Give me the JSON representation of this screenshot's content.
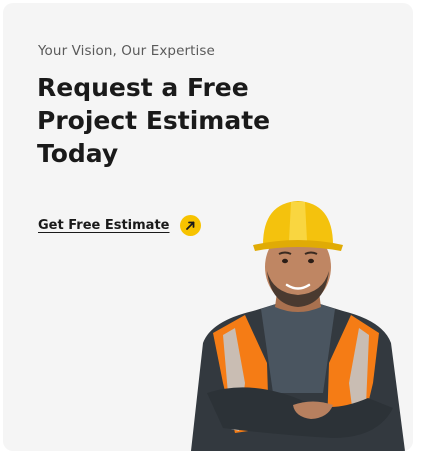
{
  "hero": {
    "tagline": "Your Vision, Our Expertise",
    "headline_lines": [
      "Request a Free",
      "Project Estimate",
      "Today"
    ],
    "cta_label": "Get Free Estimate",
    "cta_icon": "arrow-up-right-icon"
  },
  "colors": {
    "card_background": "#f5f5f5",
    "accent": "#f7c300",
    "text_primary": "#1a1a1a",
    "text_secondary": "#5a5a5a"
  }
}
